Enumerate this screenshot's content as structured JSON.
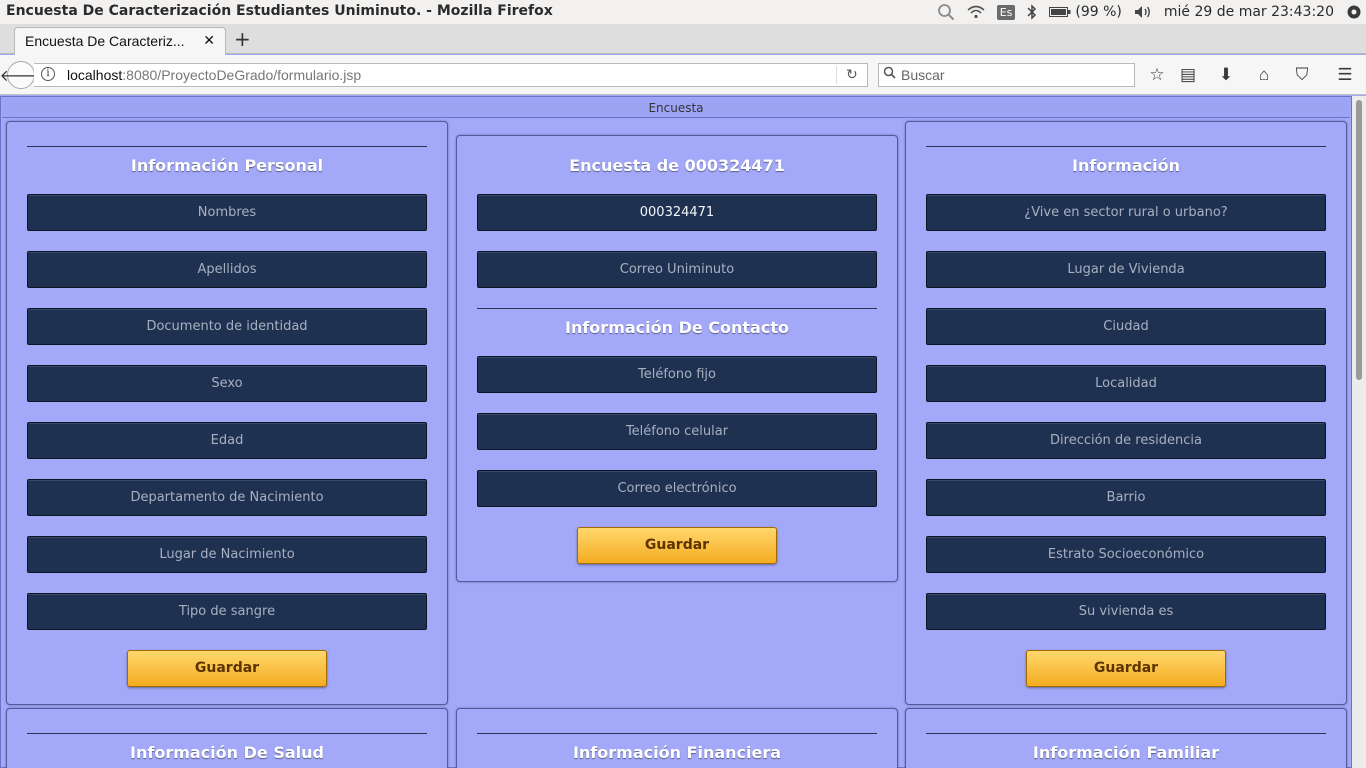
{
  "os": {
    "window_title": "Encuesta De Caracterización Estudiantes Uniminuto. - Mozilla Firefox",
    "keyboard_layout": "Es",
    "battery": "(99 %)",
    "clock": "mié 29 de mar 23:43:20"
  },
  "browser": {
    "tab_title": "Encuesta De Caracteriz...",
    "url_host": "localhost",
    "url_path": ":8080/ProyectoDeGrado/formulario.jsp",
    "search_placeholder": "Buscar"
  },
  "page": {
    "header": "Encuesta",
    "personal": {
      "title": "Información Personal",
      "fields": [
        "Nombres",
        "Apellidos",
        "Documento de identidad",
        "Sexo",
        "Edad",
        "Departamento de Nacimiento",
        "Lugar de Nacimiento",
        "Tipo de sangre"
      ],
      "save_label": "Guardar"
    },
    "survey": {
      "title": "Encuesta de 000324471",
      "student_id_value": "000324471",
      "email_uniminuto_placeholder": "Correo Uniminuto",
      "contact_title": "Información De Contacto",
      "contact_fields": [
        "Teléfono fijo",
        "Teléfono celular",
        "Correo electrónico"
      ],
      "save_label": "Guardar"
    },
    "info": {
      "title": "Información",
      "fields": [
        "¿Vive en sector rural o urbano?",
        "Lugar de Vivienda",
        "Ciudad",
        "Localidad",
        "Dirección de residencia",
        "Barrio",
        "Estrato Socioeconómico",
        "Su vivienda es"
      ],
      "save_label": "Guardar"
    },
    "bottom_titles": {
      "health": "Información De Salud",
      "financial": "Información Financiera",
      "family": "Información Familiar"
    }
  }
}
